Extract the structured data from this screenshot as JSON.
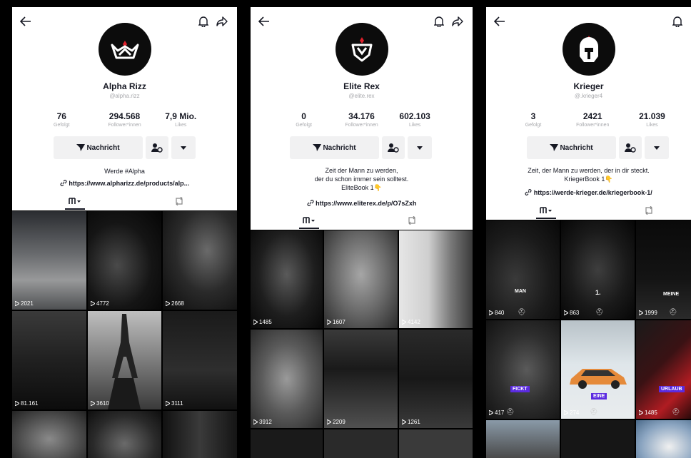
{
  "colors": {
    "bg": "#000000",
    "card": "#ffffff",
    "button": "#f1f1f2",
    "text": "#161823",
    "muted": "#a8a9ad",
    "accent": "#fe2c55",
    "overlay_pill": "#5b2be0"
  },
  "icons": {
    "back": "arrow-left-icon",
    "bell": "bell-icon",
    "share": "share-icon",
    "message": "message-arrow-icon",
    "friend": "add-friend-icon",
    "more": "caret-down-icon",
    "grid": "grid-icon",
    "repost": "repost-icon",
    "play": "play-icon"
  },
  "profiles": [
    {
      "name": "Alpha Rizz",
      "handle": "@alpha.rizz",
      "stats": [
        {
          "value": "76",
          "label": "Gefolgt"
        },
        {
          "value": "294.568",
          "label": "Follower*innen"
        },
        {
          "value": "7,9 Mio.",
          "label": "Likes"
        }
      ],
      "message_label": "Nachricht",
      "bio": "Werde #Alpha",
      "link": "https://www.alpharizz.de/products/alp...",
      "tiles": [
        {
          "views": "2021"
        },
        {
          "views": "4772"
        },
        {
          "views": "2668"
        },
        {
          "views": "81.161"
        },
        {
          "views": "3610"
        },
        {
          "views": "3111"
        },
        {
          "views": ""
        },
        {
          "views": ""
        },
        {
          "views": ""
        }
      ]
    },
    {
      "name": "Elite Rex",
      "handle": "@elite.rex",
      "stats": [
        {
          "value": "0",
          "label": "Gefolgt"
        },
        {
          "value": "34.176",
          "label": "Follower*innen"
        },
        {
          "value": "602.103",
          "label": "Likes"
        }
      ],
      "message_label": "Nachricht",
      "bio_lines": [
        "Zeit der Mann zu werden,",
        "der du schon immer sein solltest.",
        "EliteBook 1👇"
      ],
      "link": "https://www.eliterex.de/p/O7sZxh",
      "tiles": [
        {
          "views": "1485"
        },
        {
          "views": "1607"
        },
        {
          "views": "4142"
        },
        {
          "views": "3912"
        },
        {
          "views": "2209"
        },
        {
          "views": "1261"
        },
        {
          "views": ""
        },
        {
          "views": ""
        },
        {
          "views": ""
        }
      ]
    },
    {
      "name": "Krieger",
      "handle": "@.krieger4",
      "stats": [
        {
          "value": "3",
          "label": "Gefolgt"
        },
        {
          "value": "2421",
          "label": "Follower*innen"
        },
        {
          "value": "21.039",
          "label": "Likes"
        }
      ],
      "message_label": "Nachricht",
      "bio_lines": [
        "Zeit, der Mann zu werden, der in dir steckt.",
        "KriegerBook 1👇"
      ],
      "link": "https://werde-krieger.de/kriegerbook-1/",
      "tiles": [
        {
          "views": "840",
          "overlay": "MAN"
        },
        {
          "views": "863",
          "overlay": "1."
        },
        {
          "views": "1999",
          "overlay": "MEINE"
        },
        {
          "views": "417",
          "overlay": "FICKT"
        },
        {
          "views": "274",
          "overlay": "EINE"
        },
        {
          "views": "1485",
          "overlay": "URLAUB"
        },
        {
          "views": ""
        },
        {
          "views": ""
        },
        {
          "views": ""
        }
      ]
    }
  ]
}
